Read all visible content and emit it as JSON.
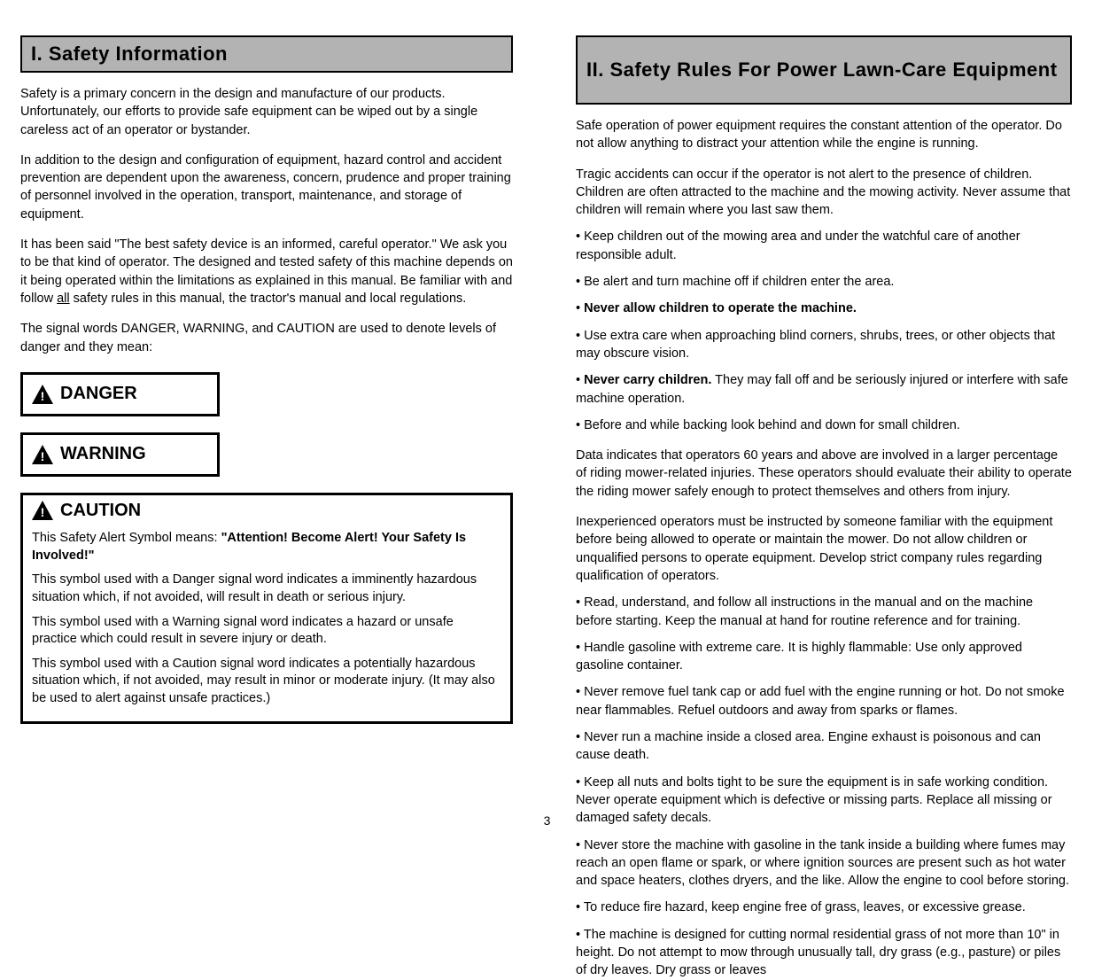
{
  "left": {
    "header": "I.  Safety Information",
    "p1": "Safety is a primary concern in the design and manufacture of our products. Unfortunately, our efforts to provide safe equipment can be wiped out by a single careless act of an operator or bystander.",
    "p2": "In addition to the design and configuration of equipment, hazard control and accident prevention are dependent upon the awareness, concern, prudence and proper training of personnel involved in the operation, transport, maintenance, and storage of equipment.",
    "p3a": "It has been said \"The best safety device is an informed, careful operator.\" We ask you to be that kind of operator.",
    "p3b_prefix": "The designed and tested safety of this machine depends on it being operated within the limitations as explained in this manual.  Be familiar with and follow ",
    "p3b_underlined": "all",
    "p3b_suffix": " safety rules in this manual, the tractor's manual and local regulations.",
    "p4": "The signal words DANGER, WARNING, and CAUTION are used to denote levels of danger and they mean:",
    "danger_label": "DANGER",
    "warning_label": "WARNING",
    "caution_label": "CAUTION",
    "caution_body": {
      "p1_prefix": "This Safety Alert Symbol means: ",
      "p1_bold": "\"Attention! Become Alert!  Your Safety Is Involved!\"",
      "p2": "This symbol used with a Danger signal word indicates a imminently hazardous situation which, if not avoided, will result in death or serious injury.",
      "p3": "This symbol used with a Warning signal word indicates a hazard or unsafe practice which could result in severe injury or death.",
      "p4": "This symbol used with a Caution signal word indicates a potentially hazardous situation which, if not avoided, may result in minor or moderate injury. (It may also be used to alert against unsafe practices.)"
    }
  },
  "right": {
    "header": "II.  Safety Rules For Power Lawn-Care Equipment",
    "p1": "Safe operation of power equipment requires the constant attention of the operator.  Do not allow anything to distract your attention while the engine is running.",
    "p2": "Tragic accidents can occur if the operator is not alert to the presence of children.  Children are often attracted to the machine and the mowing activity.  Never assume that children will remain where you last saw them.",
    "l1": "• Keep children out of the mowing area and under the watchful care of another responsible adult.",
    "l2": "• Be alert and turn machine off if children enter the area.",
    "l3_prefix": "• ",
    "l3_bold": "Never allow children to operate the machine.",
    "l4": "• Use extra care when approaching blind corners, shrubs, trees, or other objects that may obscure vision.",
    "l5_prefix": "• ",
    "l5_bold": "Never carry children.",
    "l5_suffix": " They may fall off and be seriously injured or interfere with safe machine operation.",
    "l6": "• Before and while backing look behind and down for small children.",
    "p3": "Data indicates that operators 60 years and above are involved in a larger percentage of riding mower-related injuries.  These operators should evaluate their ability to operate the riding mower safely enough to protect themselves and others from injury.",
    "p4": "Inexperienced operators must be instructed by someone familiar with the equipment before being allowed to operate or maintain the mower.  Do not allow children or unqualified persons to operate equipment.  Develop strict company rules regarding qualification of operators.",
    "l7": "• Read, understand, and follow all instructions in the manual and on the machine before starting.  Keep the manual at hand for routine reference and for training.",
    "l8": "• Handle gasoline with extreme care.  It is highly flammable:  Use only approved gasoline container.",
    "l9": "• Never remove fuel tank cap or add fuel with the engine running or hot.  Do not smoke near flammables.  Refuel outdoors and away from sparks or flames.",
    "l10": "• Never run a machine inside a closed area.  Engine exhaust is poisonous and can cause death.",
    "l11": "• Keep all nuts and bolts tight to be sure the equipment is in safe working condition.  Never operate equipment which is defective or missing parts. Replace all missing or damaged safety decals.",
    "l12": "• Never store the machine with gasoline in the tank inside a building where fumes may reach an open flame or spark, or where ignition sources are present such as hot water and space heaters, clothes dryers, and the like.  Allow the engine to cool before storing.",
    "l13": "• To reduce fire hazard, keep engine free of grass, leaves, or excessive grease.",
    "l14": "• The machine is designed for cutting normal residential grass of not more than 10\" in height.  Do not attempt to mow through unusually tall, dry grass (e.g., pasture) or piles of dry leaves.  Dry grass or leaves"
  },
  "page_number": "3"
}
